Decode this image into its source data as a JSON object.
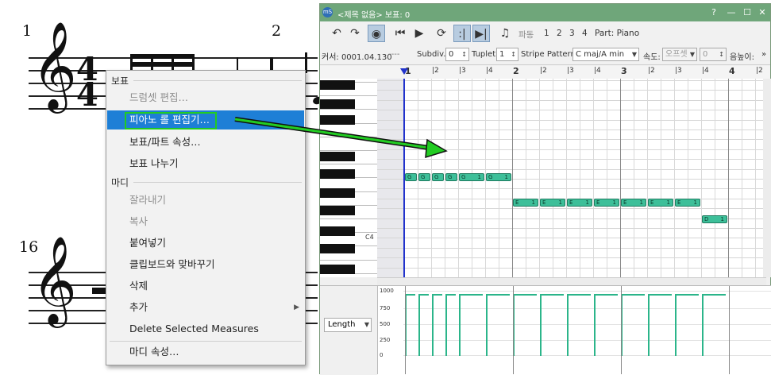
{
  "score": {
    "measure_numbers": [
      "1",
      "2",
      "16"
    ],
    "time_signature_top": "4",
    "time_signature_bottom": "4"
  },
  "context_menu": {
    "section_score": "보표",
    "drumset_edit": "드럼셋 편집…",
    "piano_roll_editor": "피아노 롤 편집기…",
    "staff_part_props": "보표/파트 속성…",
    "split_staff": "보표 나누기",
    "section_measure": "마디",
    "cut": "잘라내기",
    "copy": "복사",
    "paste": "붙여넣기",
    "swap_clipboard": "클립보드와 맞바꾸기",
    "delete": "삭제",
    "insert": "추가",
    "delete_selected_measures": "Delete Selected Measures",
    "measure_props": "마디 속성…"
  },
  "piano_roll": {
    "window_title": "<제목 없음> 보표: 0",
    "app_icon_text": "mS",
    "toolbar": {
      "undo_icon": "↶",
      "redo_icon": "↷",
      "rewind_icon": "⏮",
      "play_icon": "▶",
      "loop_icon": "⟳",
      "pedal_label": "파동",
      "voices": [
        "1",
        "2",
        "3",
        "4"
      ],
      "part_label": "Part: Piano"
    },
    "options": {
      "cursor_label": "커서: 0001.04.130",
      "cursor_extra": "----",
      "subdiv_label": "Subdiv.:",
      "subdiv_value": "0",
      "tuplet_label": "Tuplet:",
      "tuplet_value": "1",
      "stripe_label": "Stripe Pattern:",
      "stripe_value": "C maj/A min",
      "velocity_label": "속도:",
      "velocity_type": "오프셋",
      "velocity_value": "0",
      "height_label": "음높이:",
      "more": "»"
    },
    "ruler_labels": [
      {
        "text": "1",
        "major": true
      },
      {
        "text": "|2",
        "major": false
      },
      {
        "text": "|3",
        "major": false
      },
      {
        "text": "|4",
        "major": false
      },
      {
        "text": "2",
        "major": true
      },
      {
        "text": "|2",
        "major": false
      },
      {
        "text": "|3",
        "major": false
      },
      {
        "text": "|4",
        "major": false
      },
      {
        "text": "3",
        "major": true
      },
      {
        "text": "|2",
        "major": false
      },
      {
        "text": "|3",
        "major": false
      },
      {
        "text": "|4",
        "major": false
      },
      {
        "text": "4",
        "major": true
      },
      {
        "text": "|2",
        "major": false
      }
    ],
    "c4_label": "C4",
    "notes": [
      {
        "pitch": "G",
        "dur": "",
        "slot": 0,
        "len": 1,
        "row": 0
      },
      {
        "pitch": "G",
        "dur": "",
        "slot": 1,
        "len": 1,
        "row": 0
      },
      {
        "pitch": "G",
        "dur": "",
        "slot": 2,
        "len": 1,
        "row": 0
      },
      {
        "pitch": "G",
        "dur": "",
        "slot": 3,
        "len": 1,
        "row": 0
      },
      {
        "pitch": "G",
        "dur": "1",
        "slot": 4,
        "len": 2,
        "row": 0
      },
      {
        "pitch": "G",
        "dur": "1",
        "slot": 6,
        "len": 2,
        "row": 0
      },
      {
        "pitch": "E",
        "dur": "1",
        "slot": 8,
        "len": 2,
        "row": 1
      },
      {
        "pitch": "E",
        "dur": "1",
        "slot": 10,
        "len": 2,
        "row": 1
      },
      {
        "pitch": "E",
        "dur": "1",
        "slot": 12,
        "len": 2,
        "row": 1
      },
      {
        "pitch": "E",
        "dur": "1",
        "slot": 14,
        "len": 2,
        "row": 1
      },
      {
        "pitch": "E",
        "dur": "1",
        "slot": 16,
        "len": 2,
        "row": 1
      },
      {
        "pitch": "E",
        "dur": "1",
        "slot": 18,
        "len": 2,
        "row": 1
      },
      {
        "pitch": "E",
        "dur": "1",
        "slot": 20,
        "len": 2,
        "row": 1
      },
      {
        "pitch": "D",
        "dur": "1",
        "slot": 22,
        "len": 2,
        "row": 2
      }
    ],
    "velocity": {
      "dropdown": "Length",
      "axis": [
        "1000",
        "750",
        "500",
        "250",
        "0"
      ]
    },
    "colors": {
      "titlebar": "#6fa67a",
      "note_fill": "#3dbf99",
      "playhead": "#2233cc",
      "menu_highlight": "#1e7fd6",
      "callout_box": "#22cc22"
    }
  }
}
